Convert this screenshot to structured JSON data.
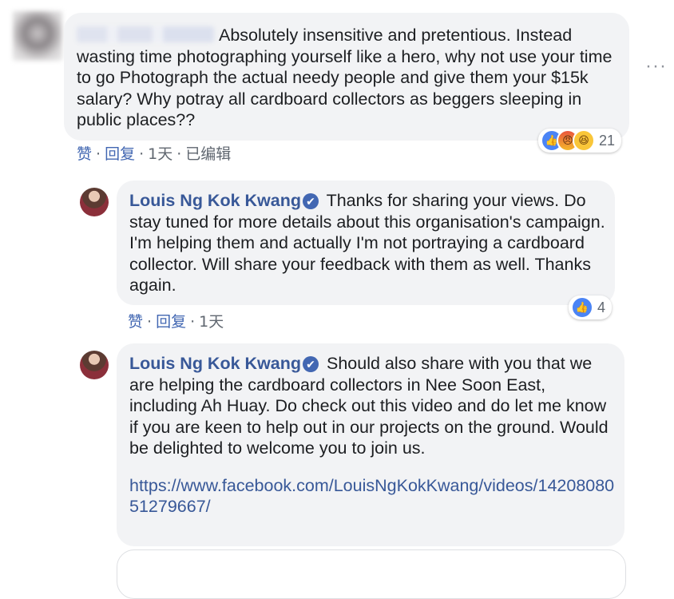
{
  "comments": [
    {
      "text": "Absolutely insensitive and pretentious. Instead wasting time photographing yourself like a hero, why not use your time to go Photograph the actual needy people and give them your $15k salary? Why potray all cardboard collectors as beggers sleeping in public places??",
      "actions": {
        "like": "赞",
        "reply": "回复",
        "time": "1天",
        "edited": "已编辑"
      },
      "reaction_count": "21"
    },
    {
      "author": "Louis Ng Kok Kwang",
      "verified_glyph": "✔",
      "text": "Thanks for sharing your views. Do stay tuned for more details about this organisation's campaign. I'm helping them and actually I'm not portraying a cardboard collector. Will share your feedback with them as well. Thanks again.",
      "actions": {
        "like": "赞",
        "reply": "回复",
        "time": "1天"
      },
      "reaction_count": "4"
    },
    {
      "author": "Louis Ng Kok Kwang",
      "verified_glyph": "✔",
      "text": "Should also share with you that we are helping the cardboard collectors in Nee Soon East, including Ah Huay. Do check out this video and do let me know if you are keen to help out in our projects on the ground. Would be delighted to welcome you to join us.",
      "link": "https://www.facebook.com/LouisNgKokKwang/videos/1420808051279667/"
    }
  ],
  "separator": "·",
  "icons": {
    "like": "like-icon",
    "angry": "angry-icon",
    "haha": "haha-icon",
    "more": "more-options-icon"
  },
  "colors": {
    "bubble": "#f2f3f5",
    "author": "#385898",
    "link": "#385898",
    "action": "#4267b2",
    "meta": "#606770"
  }
}
